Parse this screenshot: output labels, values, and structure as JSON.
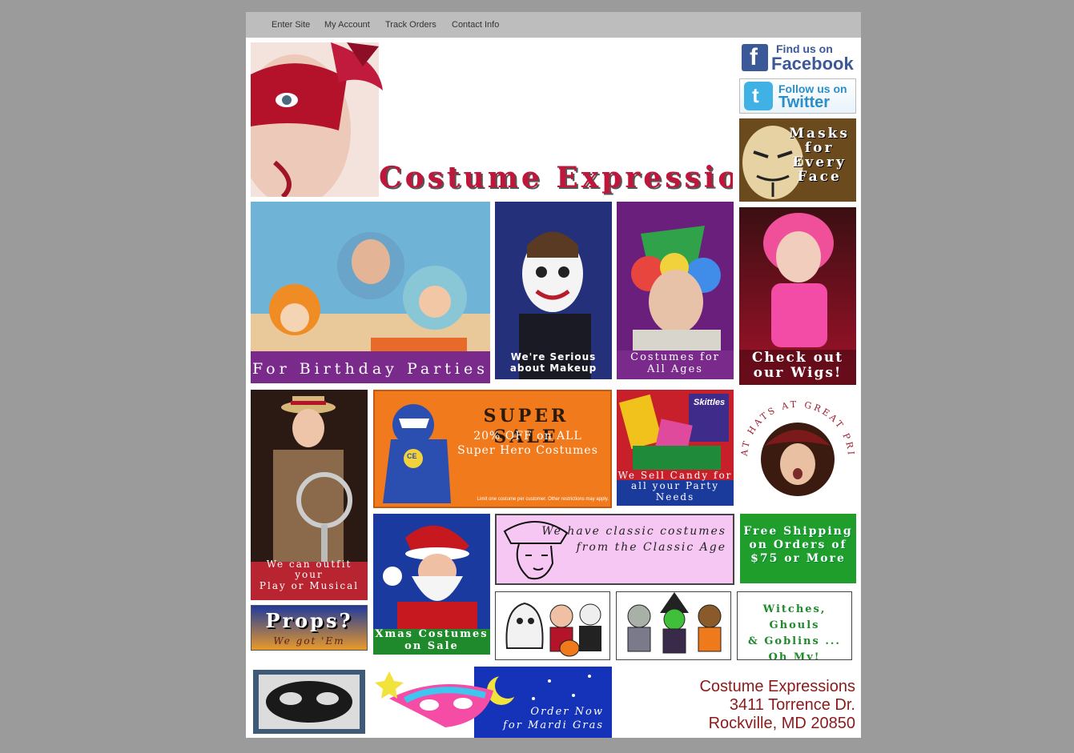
{
  "nav": {
    "items": [
      "Enter Site",
      "My Account",
      "Track Orders",
      "Contact Info"
    ]
  },
  "header": {
    "title": "Costume Expressions"
  },
  "social": {
    "facebook_top": "Find us on",
    "facebook_bottom": "Facebook",
    "twitter_top": "Follow us on",
    "twitter_bottom": "Twitter"
  },
  "promos": {
    "masks": [
      "Masks",
      "for",
      "Every",
      "Face"
    ],
    "birthday": "For Birthday Parties",
    "makeup": [
      "We're Serious",
      "about Makeup"
    ],
    "ages": [
      "Costumes for",
      "All Ages"
    ],
    "wigs": [
      "Check out",
      "our Wigs!"
    ],
    "play": [
      "We can outfit your",
      "Play or Musical"
    ],
    "supersale_title": "SUPER SALE",
    "supersale_line1": "20% OFF on ALL",
    "supersale_line2": "Super Hero Costumes",
    "supersale_fine": "Limit one costume per customer. Other restrictions may apply.",
    "supersale_logo": "CE",
    "candy": [
      "We Sell Candy for",
      "all your Party Needs"
    ],
    "candy_brand": "Skittles",
    "hats": "GREAT HATS AT GREAT PRICES",
    "props_title": "Props?",
    "props_sub": "We got 'Em",
    "xmas": [
      "Xmas Costumes",
      "on Sale"
    ],
    "classic": [
      "We have classic costumes",
      "from the Classic Age"
    ],
    "shipping": [
      "Free Shipping",
      "on Orders of",
      "$75 or More"
    ],
    "witches": [
      "Witches, Ghouls",
      "& Goblins ...",
      "Oh My!"
    ],
    "mardigras": [
      "Order Now",
      "for Mardi Gras"
    ]
  },
  "address": {
    "name": "Costume Expressions",
    "street": "3411 Torrence Dr.",
    "city": "Rockville, MD 20850"
  },
  "colors": {
    "background": "#9b9b9b",
    "nav": "#bdbdbd",
    "address_text": "#8b1a1a",
    "purple_caption": "#7a2a8a",
    "shipping_green": "#1f9e2b"
  }
}
